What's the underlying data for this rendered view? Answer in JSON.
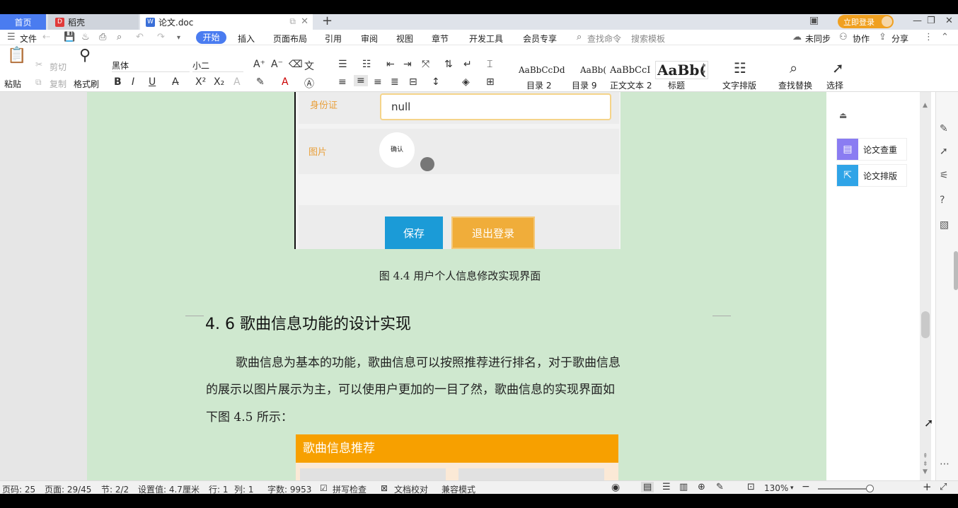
{
  "tabs": {
    "home": "首页",
    "daoke": "稻壳",
    "doc": "论文.doc",
    "add": "+"
  },
  "login_label": "立即登录",
  "menu": {
    "file": "文件",
    "items": [
      "开始",
      "插入",
      "页面布局",
      "引用",
      "审阅",
      "视图",
      "章节",
      "开发工具",
      "会员专享"
    ],
    "search_cmd": "查找命令",
    "search_template": "搜索模板",
    "sync": "未同步",
    "collab": "协作",
    "share": "分享"
  },
  "ribbon": {
    "paste": "粘贴",
    "cut": "剪切",
    "copy": "复制",
    "format_painter": "格式刷",
    "font_name": "黑体",
    "font_size": "小二",
    "styles": [
      {
        "preview": "AaBbCcDd",
        "label": "目录 2"
      },
      {
        "preview": "AaBb(",
        "label": "目录 9"
      },
      {
        "preview": "AaBbCcI",
        "label": "正文文本 2"
      },
      {
        "preview": "AaBb(",
        "label": "标题"
      }
    ],
    "text_layout": "文字排版",
    "find_replace": "查找替换",
    "select": "选择"
  },
  "figure_top": {
    "id_label": "身份证",
    "id_value": "null",
    "image_label": "图片",
    "avatar_text": "确认",
    "save_btn": "保存",
    "logout_btn": "退出登录"
  },
  "caption": "图 4.4 用户个人信息修改实现界面",
  "heading": "4. 6 歌曲信息功能的设计实现",
  "paragraph_lines": [
    "歌曲信息为基本的功能，歌曲信息可以按照推荐进行排名，对于歌曲信息",
    "的展示以图片展示为主，可以使用户更加的一目了然，歌曲信息的实现界面如",
    "下图 4.5 所示："
  ],
  "figure2": {
    "header": "歌曲信息推荐"
  },
  "sidebar": {
    "check": "论文查重",
    "layout": "论文排版"
  },
  "status": {
    "page_num": "页码: 25",
    "page": "页面: 29/45",
    "section": "节: 2/2",
    "setting": "设置值: 4.7厘米",
    "row": "行: 1",
    "col": "列: 1",
    "words": "字数: 9953",
    "spell": "拼写检查",
    "proof": "文档校对",
    "compat": "兼容模式",
    "zoom": "130%"
  },
  "colors": {
    "accent": "#4a7cf0",
    "page_bg": "#cfe8cf",
    "save_btn": "#1b9bd7",
    "logout_btn": "#f0ad3a",
    "figure2_header": "#f7a000"
  }
}
